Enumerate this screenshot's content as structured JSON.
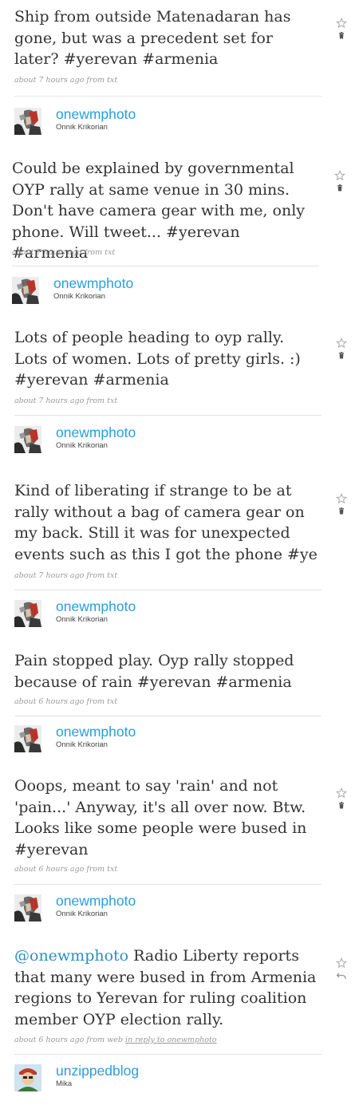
{
  "tweets": [
    {
      "text": "Ship from outside Matenadaran has gone, but was a precedent set for later? #yerevan #armenia",
      "meta": "about 7 hours ago from txt"
    },
    {
      "text": "Could be explained by governmental OYP rally at same venue in 30 mins. Don't have camera gear with me, only phone. Will tweet... #yerevan #armenia",
      "meta": "about 7 hours ago from txt"
    },
    {
      "text": "Lots of people heading to oyp rally. Lots of women. Lots of pretty girls. :) #yerevan #armenia",
      "meta": "about 7 hours ago from txt"
    },
    {
      "text": "Kind of liberating if strange to be at rally without a bag of camera gear on my back. Still it was for unexpected events such as this I got the phone #ye",
      "meta": "about 7 hours ago from txt"
    },
    {
      "text": "Pain stopped play. Oyp rally stopped because of rain #yerevan #armenia",
      "meta": "about 6 hours ago from txt"
    },
    {
      "text": "Ooops, meant to say 'rain' and not 'pain...' Anyway, it's all over now. Btw. Looks like some people were bused in #yerevan",
      "meta": "about 6 hours ago from txt"
    },
    {
      "mention": "@onewmphoto",
      "text": " Radio Liberty reports that many were bused in from Armenia regions to Yerevan for ruling coalition member OYP election rally.",
      "meta": "about 6 hours ago from web",
      "reply_link": "in reply to onewmphoto"
    }
  ],
  "authors": [
    {
      "screen_name": "onewmphoto",
      "full_name": "Onnik Krikorian"
    },
    {
      "screen_name": "onewmphoto",
      "full_name": "Onnik Krikorian"
    },
    {
      "screen_name": "onewmphoto",
      "full_name": "Onnik Krikorian"
    },
    {
      "screen_name": "onewmphoto",
      "full_name": "Onnik Krikorian"
    },
    {
      "screen_name": "onewmphoto",
      "full_name": "Onnik Krikorian"
    },
    {
      "screen_name": "onewmphoto",
      "full_name": "Onnik Krikorian"
    },
    {
      "screen_name": "unzippedblog",
      "full_name": "Mika"
    }
  ],
  "icons": {
    "favorite": "star-outline-icon",
    "delete": "trash-icon",
    "reply": "reply-arrow-icon"
  },
  "colors": {
    "link": "#2a8fbd",
    "screen_name": "#2a9ed8",
    "text": "#333333",
    "meta": "#999999",
    "separator": "#e3e3e3"
  }
}
